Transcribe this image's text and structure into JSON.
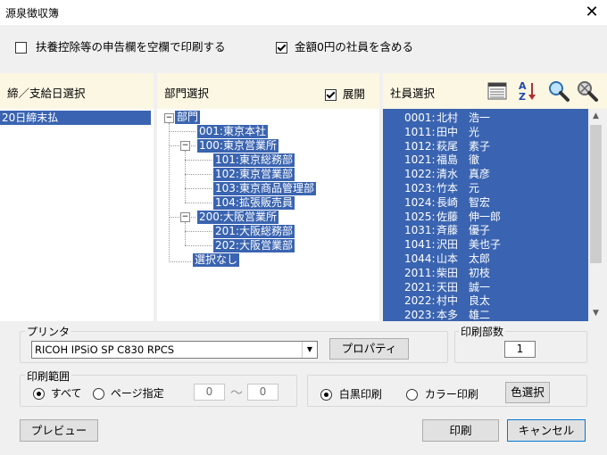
{
  "window": {
    "title": "源泉徴収簿",
    "close_glyph": "✕"
  },
  "options": {
    "print_blank": {
      "label": "扶養控除等の申告欄を空欄で印刷する",
      "checked": false
    },
    "include_zero": {
      "label": "金額0円の社員を含める",
      "checked": true
    }
  },
  "closing_pane": {
    "header": "締／支給日選択",
    "items": [
      "20日締末払"
    ]
  },
  "dept_pane": {
    "header": "部門選択",
    "expand_label": "展開",
    "expand_checked": true,
    "tree": {
      "root": "部門",
      "n001": "001:東京本社",
      "n100": "100:東京営業所",
      "n101": "101:東京総務部",
      "n102": "102:東京営業部",
      "n103": "103:東京商品管理部",
      "n104": "104:拡張販売員",
      "n200": "200:大阪営業所",
      "n201": "201:大阪総務部",
      "n202": "202:大阪営業部",
      "none": "選択なし"
    }
  },
  "emp_pane": {
    "header": "社員選択",
    "icons": [
      "list-view-icon",
      "sort-az-icon",
      "search-icon",
      "search-settings-icon"
    ],
    "employees": [
      {
        "code": "0001:",
        "name": "北村　浩一"
      },
      {
        "code": "1011:",
        "name": "田中　光"
      },
      {
        "code": "1012:",
        "name": "萩尾　素子"
      },
      {
        "code": "1021:",
        "name": "福島　徹"
      },
      {
        "code": "1022:",
        "name": "清水　真彦"
      },
      {
        "code": "1023:",
        "name": "竹本　元"
      },
      {
        "code": "1024:",
        "name": "長崎　智宏"
      },
      {
        "code": "1025:",
        "name": "佐藤　伸一郎"
      },
      {
        "code": "1031:",
        "name": "斉藤　優子"
      },
      {
        "code": "1041:",
        "name": "沢田　美也子"
      },
      {
        "code": "1044:",
        "name": "山本　太郎"
      },
      {
        "code": "2011:",
        "name": "柴田　初枝"
      },
      {
        "code": "2021:",
        "name": "天田　誠一"
      },
      {
        "code": "2022:",
        "name": "村中　良太"
      },
      {
        "code": "2023:",
        "name": "本多　雄二"
      }
    ]
  },
  "printer": {
    "group_label": "プリンタ",
    "selected": "RICOH IPSiO SP C830 RPCS",
    "properties_label": "プロパティ"
  },
  "copies": {
    "group_label": "印刷部数",
    "value": "1"
  },
  "range": {
    "group_label": "印刷範囲",
    "all_label": "すべて",
    "pages_label": "ページ指定",
    "from": "0",
    "to": "0",
    "separator": "〜",
    "selected": "all"
  },
  "color": {
    "mono_label": "白黒印刷",
    "color_label": "カラー印刷",
    "select_label": "色選択",
    "selected": "mono"
  },
  "actions": {
    "preview_label": "プレビュー",
    "print_label": "印刷",
    "cancel_label": "キャンセル"
  }
}
